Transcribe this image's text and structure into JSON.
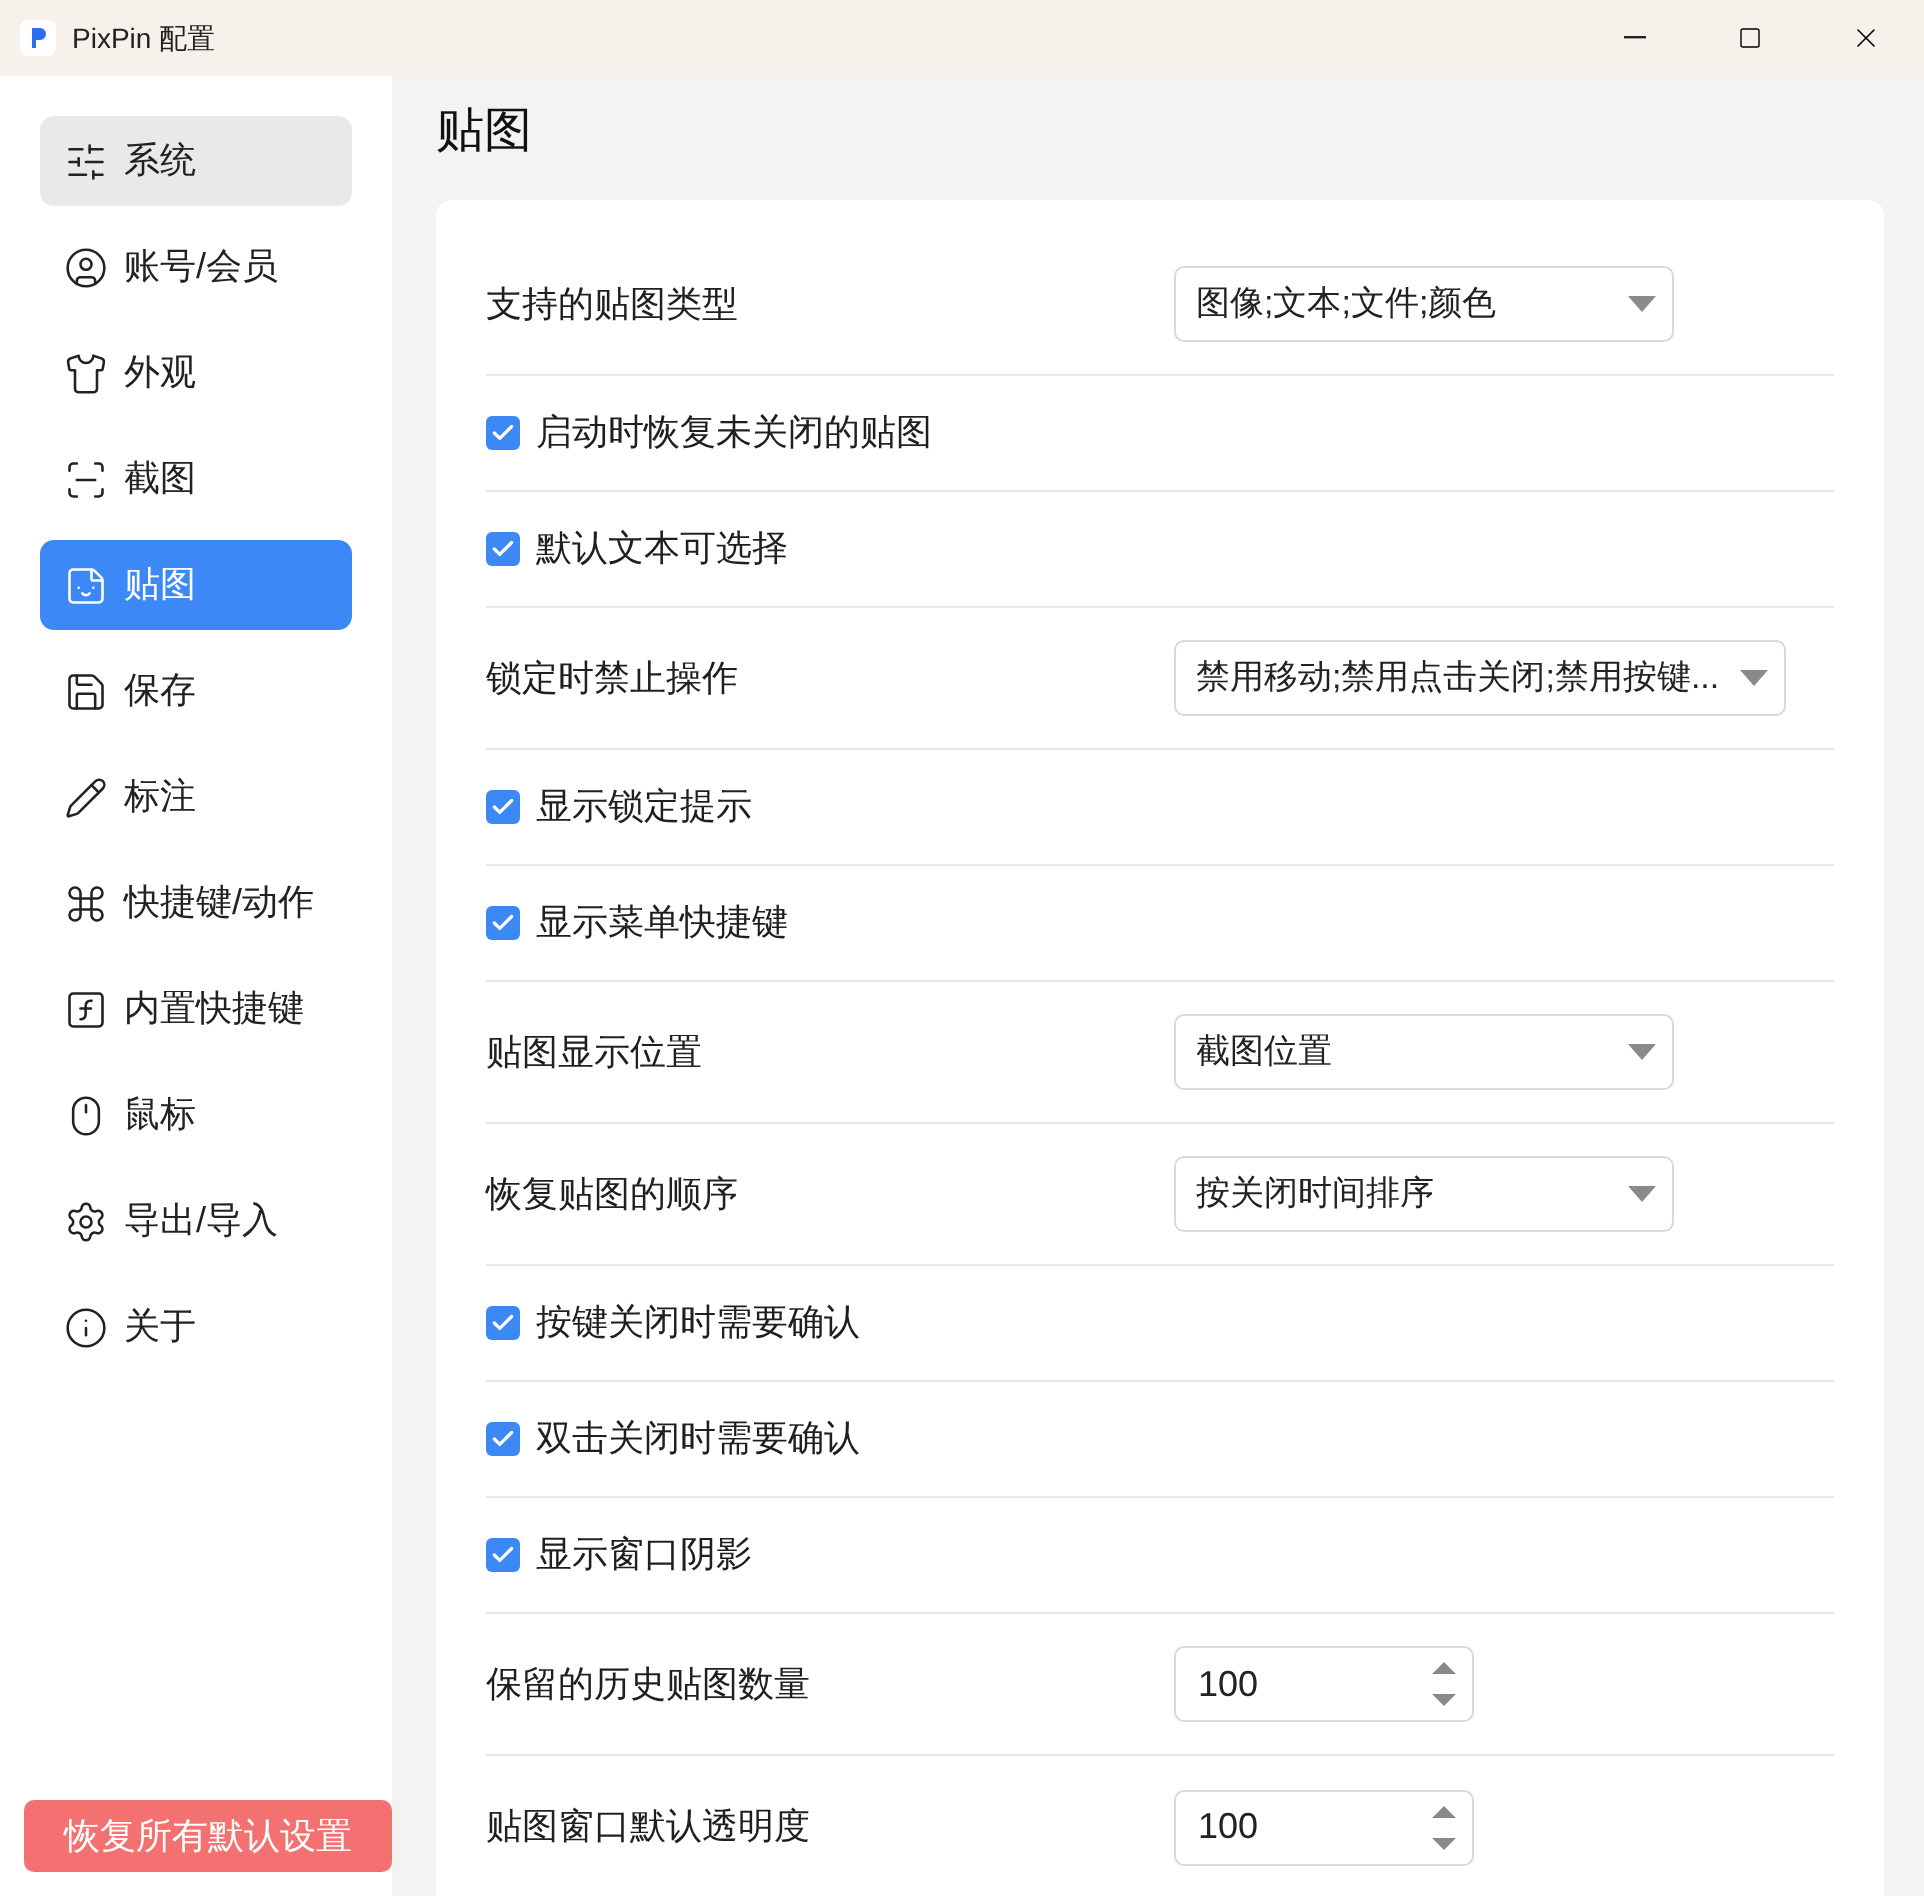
{
  "window": {
    "title": "PixPin 配置"
  },
  "sidebar": {
    "items": [
      {
        "label": "系统",
        "selected": false,
        "hovered": true
      },
      {
        "label": "账号/会员",
        "selected": false,
        "hovered": false
      },
      {
        "label": "外观",
        "selected": false,
        "hovered": false
      },
      {
        "label": "截图",
        "selected": false,
        "hovered": false
      },
      {
        "label": "贴图",
        "selected": true,
        "hovered": false
      },
      {
        "label": "保存",
        "selected": false,
        "hovered": false
      },
      {
        "label": "标注",
        "selected": false,
        "hovered": false
      },
      {
        "label": "快捷键/动作",
        "selected": false,
        "hovered": false
      },
      {
        "label": "内置快捷键",
        "selected": false,
        "hovered": false
      },
      {
        "label": "鼠标",
        "selected": false,
        "hovered": false
      },
      {
        "label": "导出/导入",
        "selected": false,
        "hovered": false
      },
      {
        "label": "关于",
        "selected": false,
        "hovered": false
      }
    ],
    "reset_button": "恢复所有默认设置"
  },
  "page": {
    "title": "贴图",
    "settings": [
      {
        "kind": "select",
        "label": "支持的贴图类型",
        "value": "图像;文本;文件;颜色"
      },
      {
        "kind": "checkbox",
        "label": "启动时恢复未关闭的贴图",
        "checked": true
      },
      {
        "kind": "checkbox",
        "label": "默认文本可选择",
        "checked": true
      },
      {
        "kind": "select",
        "label": "锁定时禁止操作",
        "value": "禁用移动;禁用点击关闭;禁用按键..."
      },
      {
        "kind": "checkbox",
        "label": "显示锁定提示",
        "checked": true
      },
      {
        "kind": "checkbox",
        "label": "显示菜单快捷键",
        "checked": true
      },
      {
        "kind": "select",
        "label": "贴图显示位置",
        "value": "截图位置"
      },
      {
        "kind": "select",
        "label": "恢复贴图的顺序",
        "value": "按关闭时间排序"
      },
      {
        "kind": "checkbox",
        "label": "按键关闭时需要确认",
        "checked": true
      },
      {
        "kind": "checkbox",
        "label": "双击关闭时需要确认",
        "checked": true
      },
      {
        "kind": "checkbox",
        "label": "显示窗口阴影",
        "checked": true
      },
      {
        "kind": "number",
        "label": "保留的历史贴图数量",
        "value": "100"
      },
      {
        "kind": "number",
        "label": "贴图窗口默认透明度",
        "value": "100"
      }
    ]
  }
}
